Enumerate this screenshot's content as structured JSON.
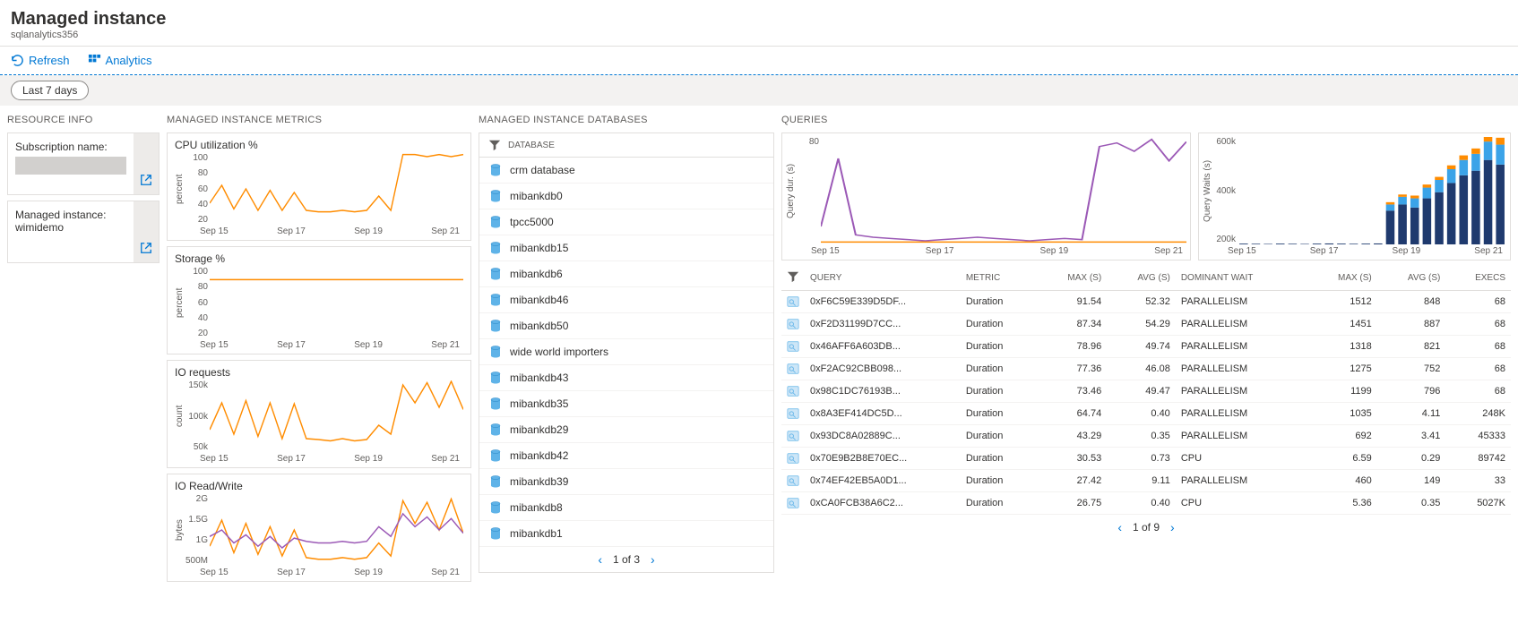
{
  "header": {
    "title": "Managed instance",
    "subtitle": "sqlanalytics356"
  },
  "toolbar": {
    "refresh": "Refresh",
    "analytics": "Analytics"
  },
  "timerange": {
    "label": "Last 7 days"
  },
  "sections": {
    "resource": "RESOURCE INFO",
    "metrics": "MANAGED INSTANCE METRICS",
    "databases": "MANAGED INSTANCE DATABASES",
    "queries": "QUERIES"
  },
  "resource": {
    "subscription_label": "Subscription name:",
    "managed_label": "Managed instance:",
    "managed_value": "wimidemo"
  },
  "db_header": "DATABASE",
  "databases": [
    "crm database",
    "mibankdb0",
    "tpcc5000",
    "mibankdb15",
    "mibankdb6",
    "mibankdb46",
    "mibankdb50",
    "wide world importers",
    "mibankdb43",
    "mibankdb35",
    "mibankdb29",
    "mibankdb42",
    "mibankdb39",
    "mibankdb8",
    "mibankdb1"
  ],
  "db_pager": "1 of 3",
  "q_pager": "1 of 9",
  "query_charts": {
    "duration_ylabel": "Query dur. (s)",
    "duration_yticks": [
      "80"
    ],
    "waits_ylabel": "Query Waits (s)",
    "waits_yticks": [
      "600k",
      "400k",
      "200k"
    ],
    "xticks": [
      "Sep 15",
      "Sep 17",
      "Sep 19",
      "Sep 21"
    ]
  },
  "query_table": {
    "headers": [
      "QUERY",
      "METRIC",
      "MAX (S)",
      "AVG (S)",
      "DOMINANT WAIT",
      "MAX (S)",
      "AVG (S)",
      "EXECS"
    ],
    "rows": [
      [
        "0xF6C59E339D5DF...",
        "Duration",
        "91.54",
        "52.32",
        "PARALLELISM",
        "1512",
        "848",
        "68"
      ],
      [
        "0xF2D31199D7CC...",
        "Duration",
        "87.34",
        "54.29",
        "PARALLELISM",
        "1451",
        "887",
        "68"
      ],
      [
        "0x46AFF6A603DB...",
        "Duration",
        "78.96",
        "49.74",
        "PARALLELISM",
        "1318",
        "821",
        "68"
      ],
      [
        "0xF2AC92CBB098...",
        "Duration",
        "77.36",
        "46.08",
        "PARALLELISM",
        "1275",
        "752",
        "68"
      ],
      [
        "0x98C1DC76193B...",
        "Duration",
        "73.46",
        "49.47",
        "PARALLELISM",
        "1199",
        "796",
        "68"
      ],
      [
        "0x8A3EF414DC5D...",
        "Duration",
        "64.74",
        "0.40",
        "PARALLELISM",
        "1035",
        "4.11",
        "248K"
      ],
      [
        "0x93DC8A02889C...",
        "Duration",
        "43.29",
        "0.35",
        "PARALLELISM",
        "692",
        "3.41",
        "45333"
      ],
      [
        "0x70E9B2B8E70EC...",
        "Duration",
        "30.53",
        "0.73",
        "CPU",
        "6.59",
        "0.29",
        "89742"
      ],
      [
        "0x74EF42EB5A0D1...",
        "Duration",
        "27.42",
        "9.11",
        "PARALLELISM",
        "460",
        "149",
        "33"
      ],
      [
        "0xCA0FCB38A6C2...",
        "Duration",
        "26.75",
        "0.40",
        "CPU",
        "5.36",
        "0.35",
        "5027K"
      ]
    ]
  },
  "chart_data": [
    {
      "type": "line",
      "title": "CPU utilization %",
      "ylabel": "percent",
      "xticks": [
        "Sep 15",
        "Sep 17",
        "Sep 19",
        "Sep 21"
      ],
      "yticks": [
        "100",
        "80",
        "60",
        "40",
        "20"
      ],
      "ylim": [
        0,
        100
      ],
      "series": [
        {
          "color": "#ff8c00",
          "values": [
            30,
            55,
            22,
            50,
            20,
            48,
            20,
            45,
            20,
            18,
            18,
            20,
            18,
            20,
            40,
            20,
            98,
            98,
            95,
            98,
            95,
            98
          ]
        }
      ]
    },
    {
      "type": "line",
      "title": "Storage %",
      "ylabel": "percent",
      "xticks": [
        "Sep 15",
        "Sep 17",
        "Sep 19",
        "Sep 21"
      ],
      "yticks": [
        "100",
        "80",
        "60",
        "40",
        "20"
      ],
      "ylim": [
        0,
        100
      ],
      "series": [
        {
          "color": "#ff8c00",
          "values": [
            82,
            82,
            82,
            82,
            82,
            82,
            82,
            82,
            82,
            82,
            82,
            82,
            82,
            82,
            82,
            82,
            82,
            82,
            82,
            82,
            82,
            82
          ]
        }
      ]
    },
    {
      "type": "line",
      "title": "IO requests",
      "ylabel": "count",
      "xticks": [
        "Sep 15",
        "Sep 17",
        "Sep 19",
        "Sep 21"
      ],
      "yticks": [
        "150k",
        "100k",
        "50k"
      ],
      "ylim": [
        0,
        160000
      ],
      "series": [
        {
          "color": "#ff8c00",
          "values": [
            50000,
            110000,
            40000,
            115000,
            35000,
            110000,
            30000,
            108000,
            30000,
            28000,
            25000,
            30000,
            25000,
            28000,
            60000,
            40000,
            150000,
            110000,
            155000,
            100000,
            158000,
            95000
          ]
        }
      ]
    },
    {
      "type": "line",
      "title": "IO Read/Write",
      "ylabel": "bytes",
      "xticks": [
        "Sep 15",
        "Sep 17",
        "Sep 19",
        "Sep 21"
      ],
      "yticks": [
        "2G",
        "1.5G",
        "1G",
        "500M"
      ],
      "ylim": [
        0,
        2200000000
      ],
      "series": [
        {
          "color": "#ff8c00",
          "values": [
            600000000,
            1400000000,
            400000000,
            1300000000,
            350000000,
            1200000000,
            300000000,
            1100000000,
            250000000,
            200000000,
            200000000,
            250000000,
            200000000,
            250000000,
            700000000,
            300000000,
            2000000000,
            1300000000,
            1950000000,
            1100000000,
            2050000000,
            1000000000
          ]
        },
        {
          "color": "#9b59b6",
          "values": [
            900000000,
            1100000000,
            700000000,
            950000000,
            600000000,
            900000000,
            550000000,
            850000000,
            750000000,
            700000000,
            700000000,
            750000000,
            700000000,
            750000000,
            1200000000,
            900000000,
            1600000000,
            1200000000,
            1500000000,
            1100000000,
            1450000000,
            1000000000
          ]
        }
      ]
    }
  ],
  "query_duration_chart": {
    "type": "line",
    "ylim": [
      0,
      90
    ],
    "series": [
      {
        "color": "#9b59b6",
        "values": [
          15,
          72,
          8,
          6,
          5,
          4,
          3,
          4,
          5,
          6,
          5,
          4,
          3,
          4,
          5,
          4,
          82,
          85,
          78,
          88,
          70,
          86
        ]
      },
      {
        "color": "#ff8c00",
        "values": [
          2,
          2,
          2,
          2,
          2,
          2,
          2,
          2,
          2,
          2,
          2,
          2,
          2,
          2,
          2,
          2,
          2,
          2,
          2,
          2,
          2,
          2
        ]
      }
    ]
  },
  "query_waits_chart": {
    "type": "bar-stacked",
    "ylim": [
      0,
      700000
    ],
    "categories": [
      "Sep 15",
      "Sep 17",
      "Sep 19",
      "Sep 21"
    ],
    "bars": [
      [
        5000,
        0,
        0
      ],
      [
        4000,
        0,
        0
      ],
      [
        3000,
        0,
        0
      ],
      [
        5000,
        0,
        0
      ],
      [
        4000,
        0,
        0
      ],
      [
        3000,
        0,
        0
      ],
      [
        5000,
        0,
        0
      ],
      [
        6000,
        0,
        0
      ],
      [
        5000,
        0,
        0
      ],
      [
        4000,
        0,
        0
      ],
      [
        5000,
        0,
        0
      ],
      [
        6000,
        0,
        0
      ],
      [
        220000,
        40000,
        15000
      ],
      [
        260000,
        50000,
        15000
      ],
      [
        240000,
        60000,
        18000
      ],
      [
        300000,
        70000,
        20000
      ],
      [
        340000,
        80000,
        20000
      ],
      [
        400000,
        90000,
        25000
      ],
      [
        450000,
        100000,
        30000
      ],
      [
        480000,
        110000,
        35000
      ],
      [
        550000,
        120000,
        40000
      ],
      [
        520000,
        130000,
        45000
      ]
    ],
    "colors": [
      "#1f3a6e",
      "#3ba3e8",
      "#ff8c00"
    ]
  }
}
